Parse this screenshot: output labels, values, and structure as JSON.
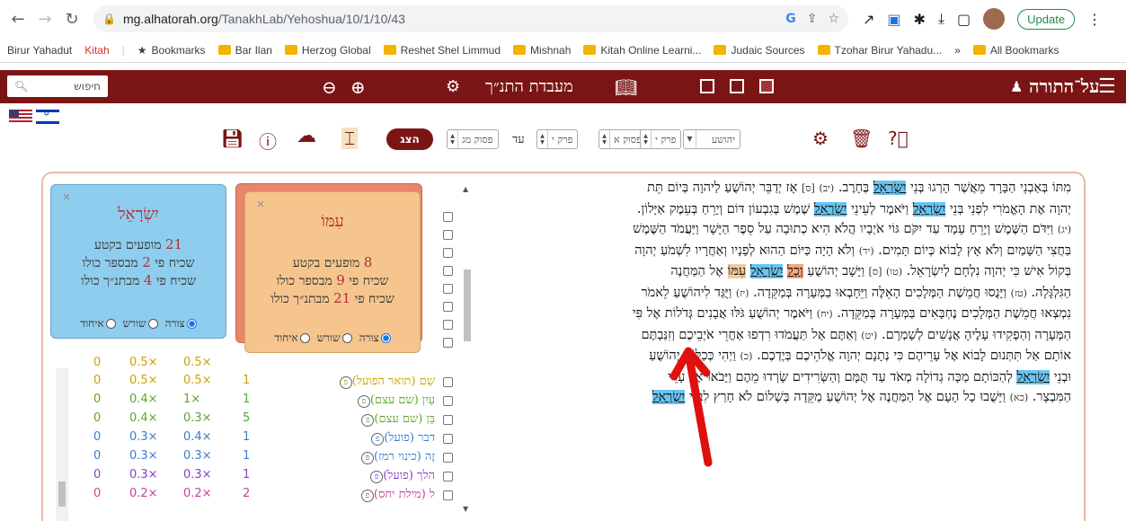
{
  "browser": {
    "url_host": "mg.alhatorah.org",
    "url_path": "/TanakhLab/Yehoshua/10/1/10/43",
    "update_label": "Update"
  },
  "bookmarks": [
    {
      "label": "Birur Yahadut",
      "type": "text"
    },
    {
      "label": "Kitah",
      "type": "text-red"
    },
    {
      "label": "Bookmarks",
      "type": "star"
    },
    {
      "label": "Bar Ilan",
      "type": "folder"
    },
    {
      "label": "Herzog Global",
      "type": "folder"
    },
    {
      "label": "Reshet Shel Limmud",
      "type": "folder"
    },
    {
      "label": "Mishnah",
      "type": "folder"
    },
    {
      "label": "Kitah Online Learni...",
      "type": "folder"
    },
    {
      "label": "Judaic Sources",
      "type": "folder"
    },
    {
      "label": "Tzohar Birur Yahadu...",
      "type": "folder"
    },
    {
      "label": "»",
      "type": "text"
    },
    {
      "label": "All Bookmarks",
      "type": "folder"
    }
  ],
  "header": {
    "search_placeholder": "חיפוש",
    "lab_title": "מעבדת התנ״ך",
    "site_title": "על־התורה"
  },
  "toolbar": {
    "show_label": "הצג",
    "verse_end_label": "פסוק מג",
    "chapter_end_label": "פרק י",
    "until_label": "עד",
    "verse_start_label": "פסוק א",
    "chapter_start_label": "פרק י",
    "book_label": "יהושע"
  },
  "text_lines": [
    {
      "segments": [
        {
          "t": "מִתּוֹ בְּאַבְנֵי הַבָּרָד מֵאֲשֶׁר הָרְגוּ בְּנֵי "
        },
        {
          "t": "יִשְׂרָאֵל",
          "hl": "blue"
        },
        {
          "t": " בֶּחָרֶב. "
        },
        {
          "t": "(יב)",
          "v": true
        },
        {
          "t": " "
        },
        {
          "t": "[ס]",
          "v": true
        },
        {
          "t": " אָז יְדַבֵּר יְהוֹשֻׁעַ לַיהוָה בְּיוֹם תֵּת"
        }
      ]
    },
    {
      "segments": [
        {
          "t": "יְהוָה אֶת הָאֱמֹרִי לִפְנֵי בְּנֵי "
        },
        {
          "t": "יִשְׂרָאֵל",
          "hl": "blue"
        },
        {
          "t": " וַיֹּאמֶר לְעֵינֵי "
        },
        {
          "t": "יִשְׂרָאֵל",
          "hl": "blue"
        },
        {
          "t": " שֶׁמֶשׁ בְּגִבְעוֹן דּוֹם וְיָרֵחַ בְּעֵמֶק אַיָּלוֹן."
        }
      ]
    },
    {
      "segments": [
        {
          "t": "(יג)",
          "v": true
        },
        {
          "t": " וַיִּדֹּם הַשֶּׁמֶשׁ וְיָרֵחַ עָמָד עַד יִקֹּם גּוֹי אֹיְבָיו הֲלֹא הִיא כְתוּבָה עַל סֵפֶר הַיָּשָׁר וַיַּעֲמֹד הַשֶּׁמֶשׁ"
        }
      ]
    },
    {
      "segments": [
        {
          "t": "בַּחֲצִי הַשָּׁמַיִם וְלֹא אָץ לָבוֹא כְּיוֹם תָּמִים. "
        },
        {
          "t": "(יד)",
          "v": true
        },
        {
          "t": " וְלֹא הָיָה כַּיּוֹם הַהוּא לְפָנָיו וְאַחֲרָיו לִשְׁמֹעַ יְהוָה"
        }
      ]
    },
    {
      "segments": [
        {
          "t": "בְּקוֹל אִישׁ כִּי יְהוָה נִלְחָם לְיִשְׂרָאֵל. "
        },
        {
          "t": "(טו)",
          "v": true
        },
        {
          "t": " "
        },
        {
          "t": "[ס]",
          "v": true
        },
        {
          "t": " וַיָּשָׁב יְהוֹשֻׁעַ "
        },
        {
          "t": "וְכָל",
          "hl": "orange"
        },
        {
          "t": " "
        },
        {
          "t": "יִשְׂרָאֵל",
          "hl": "blue"
        },
        {
          "t": " "
        },
        {
          "t": "עִמּוֹ",
          "hl": "tan"
        },
        {
          "t": " אֶל הַמַּחֲנֶה"
        }
      ]
    },
    {
      "segments": [
        {
          "t": "הַגִּלְגָּלָה. "
        },
        {
          "t": "(טז)",
          "v": true
        },
        {
          "t": " וַיָּנֻסוּ חֲמֵשֶׁת הַמְּלָכִים הָאֵלֶּה וַיֵּחָבְאוּ בַמְּעָרָה בְּמַקֵּדָה. "
        },
        {
          "t": "(יז)",
          "v": true
        },
        {
          "t": " וַיֻּגַּד לִיהוֹשֻׁעַ לֵאמֹר"
        }
      ]
    },
    {
      "segments": [
        {
          "t": "נִמְצְאוּ חֲמֵשֶׁת הַמְּלָכִים נֶחְבָּאִים בַּמְּעָרָה בְּמַקֵּדָה. "
        },
        {
          "t": "(יח)",
          "v": true
        },
        {
          "t": " וַיֹּאמֶר יְהוֹשֻׁעַ גֹּלּוּ אֲבָנִים גְּדֹלוֹת אֶל פִּי"
        }
      ]
    },
    {
      "segments": [
        {
          "t": "הַמְּעָרָה וְהַפְקִידוּ עָלֶיהָ אֲנָשִׁים לְשָׁמְרָם. "
        },
        {
          "t": "(יט)",
          "v": true
        },
        {
          "t": " וְאַתֶּם אַל תַּעֲמֹדוּ רִדְפוּ אַחֲרֵי אֹיְבֵיכֶם וְזִנַּבְתֶּם"
        }
      ]
    },
    {
      "segments": [
        {
          "t": "אוֹתָם אַל תִּתְּנוּם לָבוֹא אֶל עָרֵיהֶם כִּי נְתָנָם יְהוָה אֱלֹהֵיכֶם בְּיֶדְכֶם. "
        },
        {
          "t": "(כ)",
          "v": true
        },
        {
          "t": " וַיְהִי כְּכַלּוֹת יְהוֹשֻׁעַ"
        }
      ]
    },
    {
      "segments": [
        {
          "t": "וּבְנֵי "
        },
        {
          "t": "יִשְׂרָאֵל",
          "hl": "blue"
        },
        {
          "t": " לְהַכּוֹתָם מַכָּה גְדוֹלָה מְאֹד עַד תֻּמָּם וְהַשְּׂרִידִים שָׂרְדוּ מֵהֶם וַיָּבֹאוּ אֶל עָרֵי"
        }
      ]
    },
    {
      "segments": [
        {
          "t": "הַמִּבְצָר. "
        },
        {
          "t": "(כא)",
          "v": true
        },
        {
          "t": " וַיָּשֻׁבוּ כָל הָעָם אֶל הַמַּחֲנֶה אֶל יְהוֹשֻׁעַ מַקֵּדָה בְּשָׁלוֹם לֹא חָרַץ לִבְנֵי "
        },
        {
          "t": "יִשְׂרָאֵל",
          "hl": "blue"
        }
      ]
    }
  ],
  "table_rows": [
    {
      "c1": "0",
      "c2": "0.5×",
      "c3": "0.5×",
      "c4": "1",
      "word": "שֵׁם (תואר הפועל)",
      "color": "#c9a300"
    },
    {
      "c1": "0",
      "c2": "0.4×",
      "c3": "1×",
      "c4": "1",
      "word": "עַיִן (שם עצם)",
      "color": "#5aa82a"
    },
    {
      "c1": "0",
      "c2": "0.4×",
      "c3": "0.3×",
      "c4": "5",
      "word": "בֵּן (שם עצם)",
      "color": "#5aa82a"
    },
    {
      "c1": "0",
      "c2": "0.3×",
      "c3": "0.4×",
      "c4": "1",
      "word": "דבר (פועל)",
      "color": "#3a7dc8"
    },
    {
      "c1": "0",
      "c2": "0.3×",
      "c3": "0.3×",
      "c4": "1",
      "word": "זֶה (כינוי רמז)",
      "color": "#3a7dc8"
    },
    {
      "c1": "0",
      "c2": "0.3×",
      "c3": "0.3×",
      "c4": "1",
      "word": "הלך (פועל)",
      "color": "#8a3ec8"
    },
    {
      "c1": "0",
      "c2": "0.2×",
      "c3": "0.2×",
      "c4": "2",
      "word": "ל (מילת יחס)",
      "color": "#c83e9a"
    }
  ],
  "table_partial_row": {
    "c1": "0",
    "c2": "0.5×",
    "c3": "0.5×"
  },
  "popup_blue": {
    "word": "יִשְׂרָאֵל",
    "n1": "21",
    "t1": "מופעים בקטע",
    "t2a": "שכיח פי",
    "n2": "2",
    "t2b": "מבספר כולו",
    "t3a": "שכיח פי",
    "n3": "4",
    "t3b": "מבתנ״ך כולו",
    "radio_form": "צורה",
    "radio_root": "שורש",
    "radio_unify": "איחוד"
  },
  "popup_orange": {
    "word": "עִמּוֹ",
    "n1": "8",
    "t1": "מופעים בקטע",
    "t2a": "שכיח פי",
    "n2": "9",
    "t2b": "מבספר כולו",
    "t3a": "שכיח פי",
    "n3": "21",
    "t3b": "מבתנ״ך כולו",
    "radio_form": "צורה",
    "radio_root": "שורש",
    "radio_unify": "איחוד"
  },
  "colors": {
    "brand": "#7b1515",
    "highlight_blue": "#69c5f2",
    "highlight_orange": "#f4a77a",
    "popup_orange": "#f5c58d",
    "popup_blue": "#8ecdee",
    "arrow": "#e01010"
  }
}
